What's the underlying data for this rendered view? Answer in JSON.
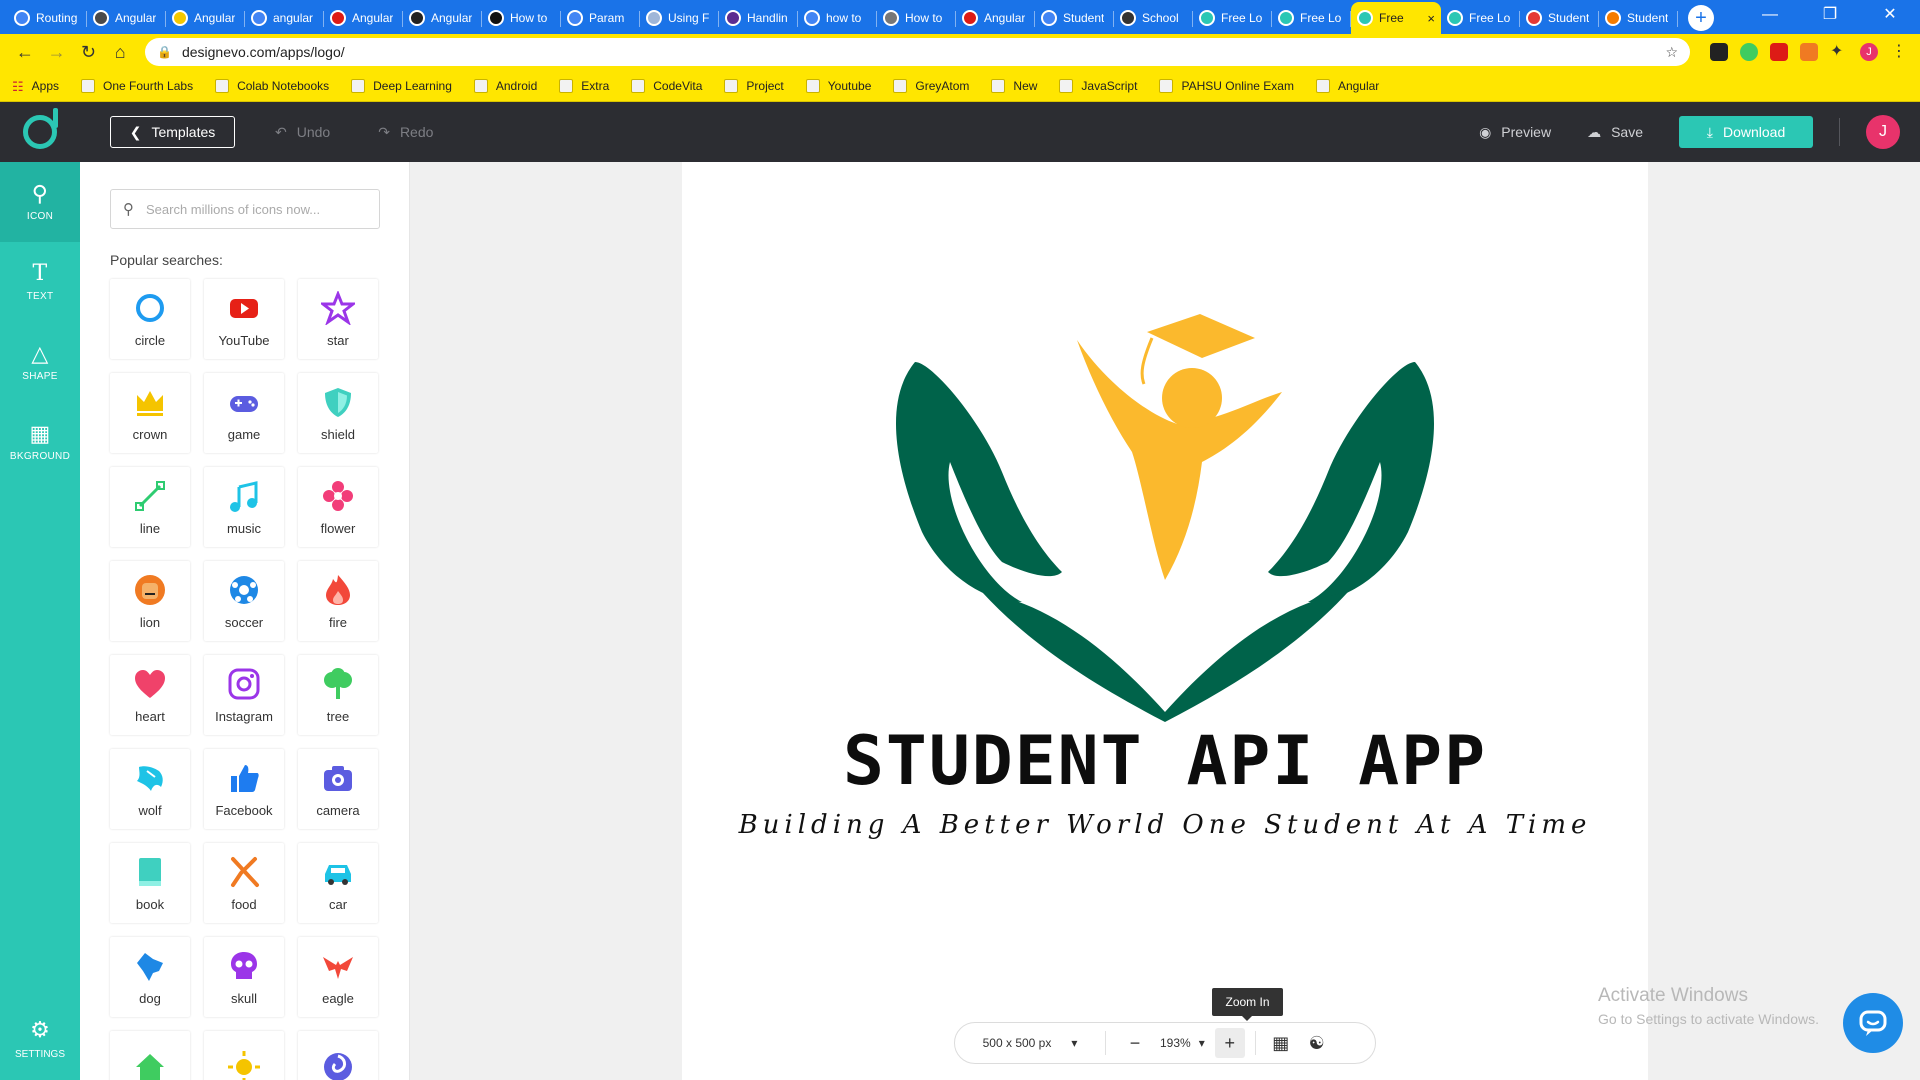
{
  "browser": {
    "tabs": [
      {
        "title": "Routing",
        "color": "#4285f4"
      },
      {
        "title": "Angular",
        "color": "#4a4a4a"
      },
      {
        "title": "Angular",
        "color": "#f5c800"
      },
      {
        "title": "angular",
        "color": "#4285f4"
      },
      {
        "title": "Angular",
        "color": "#dd1b16"
      },
      {
        "title": "Angular",
        "color": "#222222"
      },
      {
        "title": "How to",
        "color": "#111111"
      },
      {
        "title": "Param",
        "color": "#4285f4"
      },
      {
        "title": "Using F",
        "color": "#9fb6d8"
      },
      {
        "title": "Handlin",
        "color": "#5c2d91"
      },
      {
        "title": "how to",
        "color": "#4285f4"
      },
      {
        "title": "How to",
        "color": "#777777"
      },
      {
        "title": "Angular",
        "color": "#dd1b16"
      },
      {
        "title": "Student",
        "color": "#4285f4"
      },
      {
        "title": "School",
        "color": "#333333"
      },
      {
        "title": "Free Lo",
        "color": "#2bc7b4"
      },
      {
        "title": "Free Lo",
        "color": "#2bc7b4"
      },
      {
        "title": "Free",
        "color": "#2bc7b4"
      },
      {
        "title": "Free Lo",
        "color": "#2bc7b4"
      },
      {
        "title": "Student",
        "color": "#e53935"
      },
      {
        "title": "Student",
        "color": "#f57c00"
      }
    ],
    "active_tab_index": 17,
    "new_tab_label": "+",
    "url": "designevo.com/apps/logo/",
    "profile_initial": "J",
    "bookmarks": [
      "Apps",
      "One Fourth Labs",
      "Colab Notebooks",
      "Deep Learning",
      "Android",
      "Extra",
      "CodeVita",
      "Project",
      "Youtube",
      "GreyAtom",
      "New",
      "JavaScript",
      "PAHSU Online Exam",
      "Angular"
    ]
  },
  "header": {
    "templates_label": "Templates",
    "undo_label": "Undo",
    "redo_label": "Redo",
    "preview_label": "Preview",
    "save_label": "Save",
    "download_label": "Download",
    "avatar_initial": "J"
  },
  "leftnav": {
    "items": [
      {
        "label": "ICON",
        "icon": "search-icon"
      },
      {
        "label": "TEXT",
        "icon": "text-icon"
      },
      {
        "label": "SHAPE",
        "icon": "shape-icon"
      },
      {
        "label": "BKGROUND",
        "icon": "background-icon"
      }
    ],
    "settings_label": "SETTINGS"
  },
  "panel": {
    "search_placeholder": "Search millions of icons now...",
    "popular_label": "Popular searches:",
    "icons": [
      {
        "label": "circle",
        "color": "#1e9bf0"
      },
      {
        "label": "YouTube",
        "color": "#e62117"
      },
      {
        "label": "star",
        "color": "#9b35e8"
      },
      {
        "label": "crown",
        "color": "#f5c400"
      },
      {
        "label": "game",
        "color": "#5b5ce0"
      },
      {
        "label": "shield",
        "color": "#3fd0c0"
      },
      {
        "label": "line",
        "color": "#2ecc71"
      },
      {
        "label": "music",
        "color": "#1ec3e6"
      },
      {
        "label": "flower",
        "color": "#f23d79"
      },
      {
        "label": "lion",
        "color": "#f07a22"
      },
      {
        "label": "soccer",
        "color": "#1e88e5"
      },
      {
        "label": "fire",
        "color": "#f2483a"
      },
      {
        "label": "heart",
        "color": "#f0426a"
      },
      {
        "label": "Instagram",
        "color": "#9b35e8"
      },
      {
        "label": "tree",
        "color": "#3fcc60"
      },
      {
        "label": "wolf",
        "color": "#1ec3e6"
      },
      {
        "label": "Facebook",
        "color": "#1e7cf0"
      },
      {
        "label": "camera",
        "color": "#5b5ce0"
      },
      {
        "label": "book",
        "color": "#3fd0c0"
      },
      {
        "label": "food",
        "color": "#f07a22"
      },
      {
        "label": "car",
        "color": "#1ec3e6"
      },
      {
        "label": "dog",
        "color": "#1e88e5"
      },
      {
        "label": "skull",
        "color": "#9b35e8"
      },
      {
        "label": "eagle",
        "color": "#f2483a"
      },
      {
        "label": "",
        "color": "#3fcc60"
      },
      {
        "label": "",
        "color": "#f5c400"
      },
      {
        "label": "",
        "color": "#5b5ce0"
      }
    ]
  },
  "canvas": {
    "title": "STUDENT API APP",
    "tagline": "Building A Better World One Student At A Time",
    "colors": {
      "hands": "#00634a",
      "figure": "#fbb92d"
    }
  },
  "zoombar": {
    "size_label": "500 x 500 px",
    "zoom_label": "193%",
    "tooltip": "Zoom In"
  },
  "watermark": {
    "line1": "Activate Windows",
    "line2": "Go to Settings to activate Windows."
  },
  "colors": {
    "accent": "#2bc7b4",
    "chrome": "#ffe600",
    "header": "#2c2d32"
  }
}
